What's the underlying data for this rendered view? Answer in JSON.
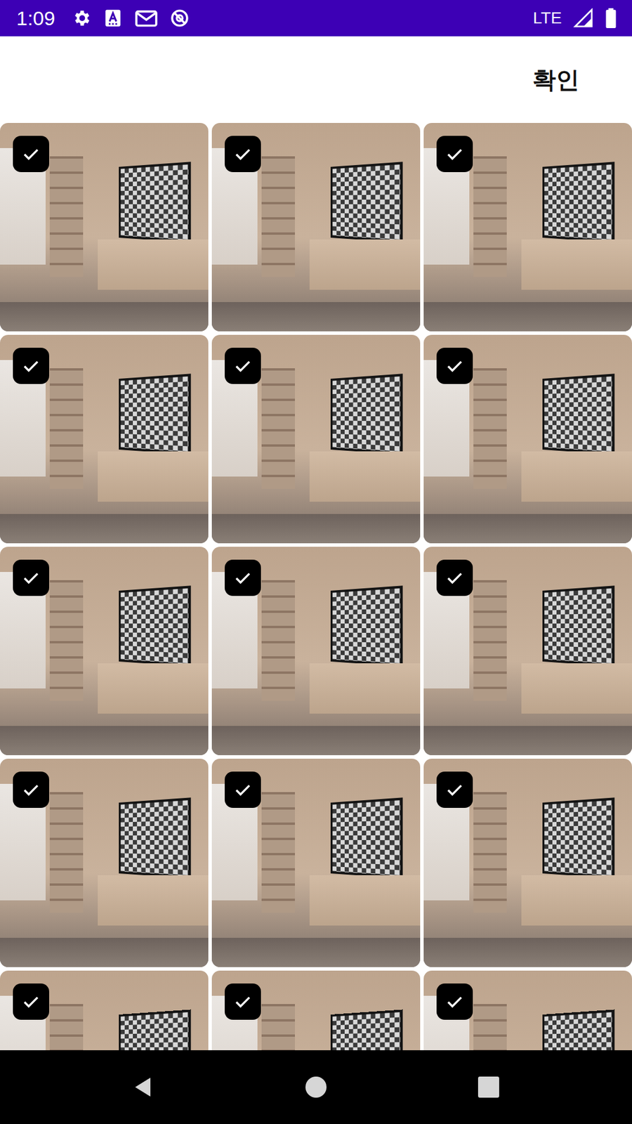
{
  "status_bar": {
    "time": "1:09",
    "network": "LTE"
  },
  "toolbar": {
    "confirm": "확인"
  },
  "photos": [
    {
      "selected": true
    },
    {
      "selected": true
    },
    {
      "selected": true
    },
    {
      "selected": true
    },
    {
      "selected": true
    },
    {
      "selected": true
    },
    {
      "selected": true
    },
    {
      "selected": true
    },
    {
      "selected": true
    },
    {
      "selected": true
    },
    {
      "selected": true
    },
    {
      "selected": true
    },
    {
      "selected": true
    },
    {
      "selected": true
    },
    {
      "selected": true
    }
  ]
}
